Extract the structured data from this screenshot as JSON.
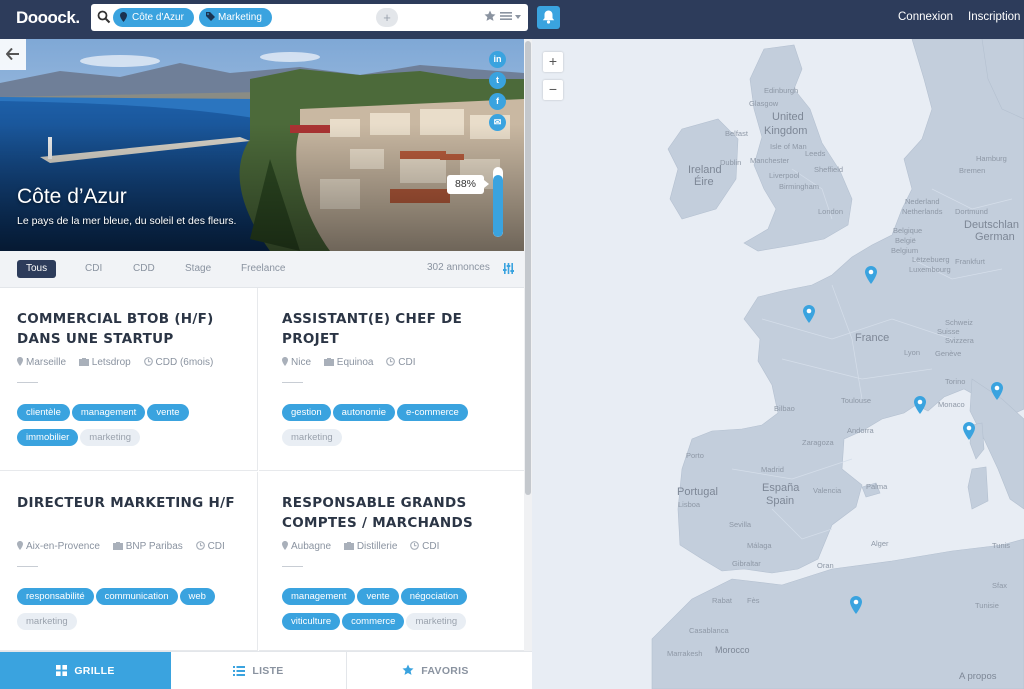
{
  "header": {
    "logo": "Dooock.",
    "chips": [
      "Côte d'Azur",
      "Marketing"
    ],
    "add_chip": "+",
    "connexion": "Connexion",
    "inscription": "Inscription"
  },
  "hero": {
    "title": "Côte d’Azur",
    "subtitle": "Le pays de la mer bleue, du soleil et des fleurs.",
    "percent_label": "88%",
    "percent_value": 0.88,
    "social": [
      "in",
      "t",
      "f",
      "✉"
    ]
  },
  "filters": {
    "tabs": [
      "Tous",
      "CDI",
      "CDD",
      "Stage",
      "Freelance"
    ],
    "count": "302 annonces"
  },
  "jobs": [
    {
      "title": "COMMERCIAL BTOB (H/F) DANS UNE STARTUP",
      "city": "Marseille",
      "company": "Letsdrop",
      "contract": "CDD (6mois)",
      "tags": [
        "clientèle",
        "management",
        "vente",
        "immobilier"
      ],
      "light_tags": [
        "marketing"
      ]
    },
    {
      "title": "ASSISTANT(E) CHEF DE PROJET",
      "city": "Nice",
      "company": "Equinoa",
      "contract": "CDI",
      "tags": [
        "gestion",
        "autonomie",
        "e-commerce"
      ],
      "light_tags": [
        "marketing"
      ]
    },
    {
      "title": "DIRECTEUR MARKETING H/F",
      "city": "Aix-en-Provence",
      "company": "BNP Paribas",
      "contract": "CDI",
      "tags": [
        "responsabilité",
        "communication",
        "web"
      ],
      "light_tags": [
        "marketing"
      ]
    },
    {
      "title": "RESPONSABLE GRANDS COMPTES / MARCHANDS",
      "city": "Aubagne",
      "company": "Distillerie",
      "contract": "CDI",
      "tags": [
        "management",
        "vente",
        "négociation",
        "viticulture",
        "commerce"
      ],
      "light_tags": [
        "marketing"
      ]
    }
  ],
  "bottom_tabs": [
    "GRILLE",
    "LISTE",
    "FAVORIS"
  ],
  "map": {
    "zoom_in": "+",
    "zoom_out": "−",
    "footer": "A propos",
    "labels": [
      {
        "text": "United",
        "big": true
      },
      {
        "text": "Kingdom",
        "big": true
      },
      {
        "text": "Ireland",
        "big": true
      },
      {
        "text": "Éire",
        "big": true
      },
      {
        "text": "France",
        "big": true
      },
      {
        "text": "España",
        "big": true
      },
      {
        "text": "Spain",
        "big": true
      },
      {
        "text": "Portugal",
        "big": true
      },
      {
        "text": "Deutschlan",
        "big": true
      },
      {
        "text": "German",
        "big": true
      },
      {
        "text": "Edinburgh"
      },
      {
        "text": "Glasgow"
      },
      {
        "text": "Belfast"
      },
      {
        "text": "Isle of Man"
      },
      {
        "text": "Leeds"
      },
      {
        "text": "Manchester"
      },
      {
        "text": "Liverpool"
      },
      {
        "text": "Sheffield"
      },
      {
        "text": "Dublin"
      },
      {
        "text": "Birmingham"
      },
      {
        "text": "London"
      },
      {
        "text": "Nederland"
      },
      {
        "text": "Netherlands"
      },
      {
        "text": "Dortmund"
      },
      {
        "text": "Belgique"
      },
      {
        "text": "België"
      },
      {
        "text": "Belgium"
      },
      {
        "text": "Frankfurt"
      },
      {
        "text": "Lëtzebuerg"
      },
      {
        "text": "Luxembourg"
      },
      {
        "text": "Hamburg"
      },
      {
        "text": "Bremen"
      },
      {
        "text": "Schweiz"
      },
      {
        "text": "Suisse"
      },
      {
        "text": "Svizzera"
      },
      {
        "text": "Genève"
      },
      {
        "text": "Lyon"
      },
      {
        "text": "Torino"
      },
      {
        "text": "Monaco"
      },
      {
        "text": "Toulouse"
      },
      {
        "text": "Bilbao"
      },
      {
        "text": "Andorra"
      },
      {
        "text": "Porto"
      },
      {
        "text": "Zaragoza"
      },
      {
        "text": "Madrid"
      },
      {
        "text": "Valencia"
      },
      {
        "text": "Palma"
      },
      {
        "text": "Lisboa"
      },
      {
        "text": "Sevilla"
      },
      {
        "text": "Málaga"
      },
      {
        "text": "Gibraltar"
      },
      {
        "text": "Oran"
      },
      {
        "text": "Alger"
      },
      {
        "text": "Tunis"
      },
      {
        "text": "Sfax"
      },
      {
        "text": "Rabat"
      },
      {
        "text": "Fès"
      },
      {
        "text": "Casablanca"
      },
      {
        "text": "Marrakesh"
      },
      {
        "text": "Morocco"
      },
      {
        "text": "Tunisie"
      }
    ]
  }
}
